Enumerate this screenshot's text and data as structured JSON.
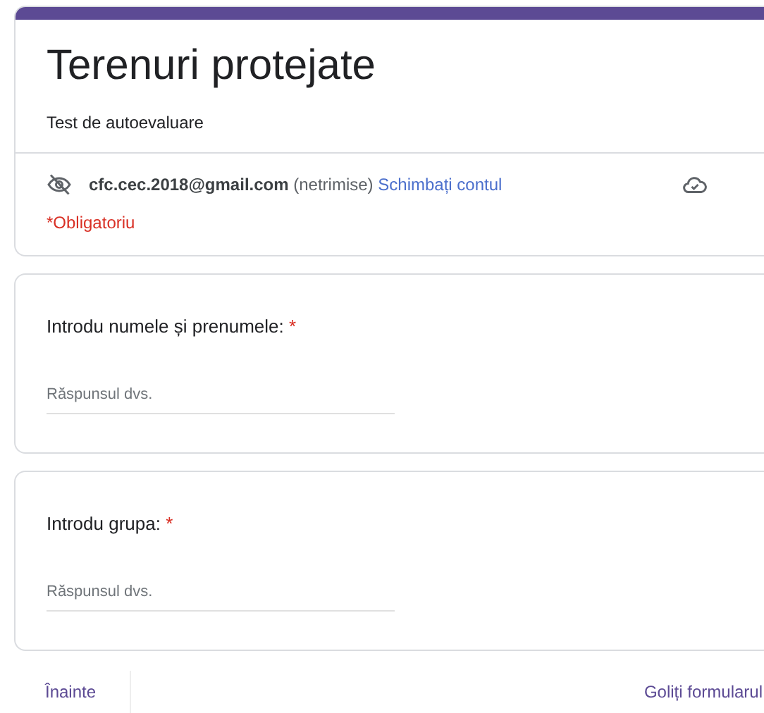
{
  "form": {
    "title": "Terenuri protejate",
    "description": "Test de autoevaluare"
  },
  "account": {
    "email": "cfc.cec.2018@gmail.com",
    "status": "(netrimise)",
    "switch_link": "Schimbați contul"
  },
  "required_note": "*Obligatoriu",
  "questions": [
    {
      "label": "Introdu numele și prenumele:",
      "required_mark": "*",
      "placeholder": "Răspunsul dvs."
    },
    {
      "label": "Introdu grupa:",
      "required_mark": "*",
      "placeholder": "Răspunsul dvs."
    }
  ],
  "footer": {
    "next_button": "Înainte",
    "clear_link": "Goliți formularul"
  }
}
